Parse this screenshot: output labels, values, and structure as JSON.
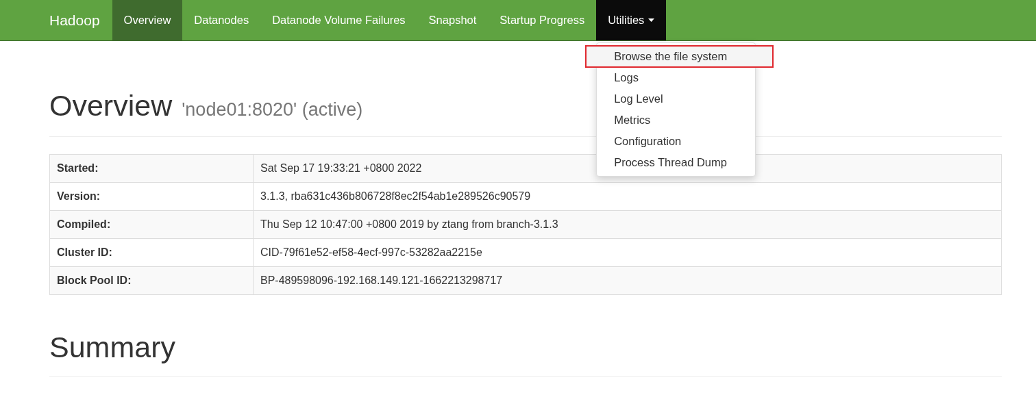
{
  "navbar": {
    "brand": "Hadoop",
    "tabs": [
      {
        "label": "Overview",
        "selected": true,
        "kind": "link"
      },
      {
        "label": "Datanodes",
        "selected": false,
        "kind": "link"
      },
      {
        "label": "Datanode Volume Failures",
        "selected": false,
        "kind": "link"
      },
      {
        "label": "Snapshot",
        "selected": false,
        "kind": "link"
      },
      {
        "label": "Startup Progress",
        "selected": false,
        "kind": "link"
      },
      {
        "label": "Utilities",
        "selected": false,
        "kind": "dropdown",
        "expanded": true
      }
    ]
  },
  "dropdown_menu": {
    "items": [
      {
        "label": "Browse the file system",
        "highlighted": true
      },
      {
        "label": "Logs",
        "highlighted": false
      },
      {
        "label": "Log Level",
        "highlighted": false
      },
      {
        "label": "Metrics",
        "highlighted": false
      },
      {
        "label": "Configuration",
        "highlighted": false
      },
      {
        "label": "Process Thread Dump",
        "highlighted": false
      }
    ]
  },
  "overview": {
    "title": "Overview",
    "subtitle": "'node01:8020' (active)",
    "rows": [
      {
        "label": "Started:",
        "value": "Sat Sep 17 19:33:21 +0800 2022"
      },
      {
        "label": "Version:",
        "value": "3.1.3, rba631c436b806728f8ec2f54ab1e289526c90579"
      },
      {
        "label": "Compiled:",
        "value": "Thu Sep 12 10:47:00 +0800 2019 by ztang from branch-3.1.3"
      },
      {
        "label": "Cluster ID:",
        "value": "CID-79f61e52-ef58-4ecf-997c-53282aa2215e"
      },
      {
        "label": "Block Pool ID:",
        "value": "BP-489598096-192.168.149.121-1662213298717"
      }
    ]
  },
  "summary": {
    "title": "Summary"
  }
}
